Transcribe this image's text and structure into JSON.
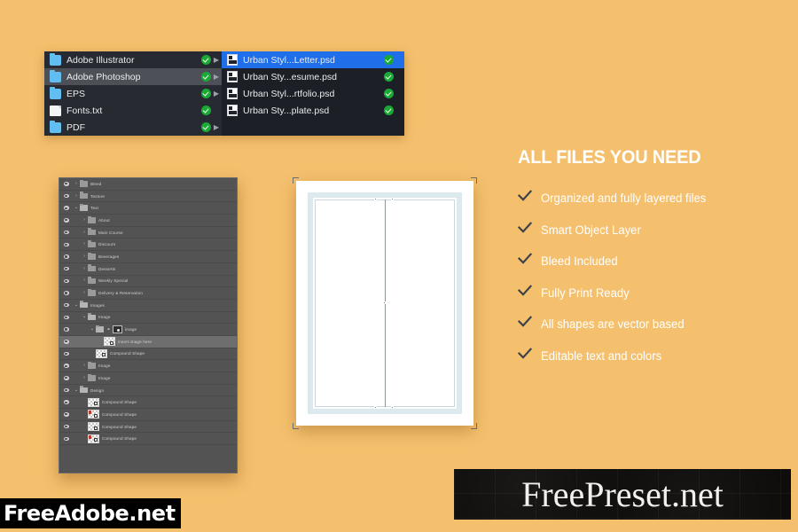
{
  "background_color": "#f4c06d",
  "file_browser": {
    "left_column": [
      {
        "name": "Adobe Illustrator",
        "icon": "folder-icon",
        "verified": true,
        "has_arrow": true,
        "selected": false
      },
      {
        "name": "Adobe Photoshop",
        "icon": "folder-icon",
        "verified": true,
        "has_arrow": true,
        "selected": true
      },
      {
        "name": "EPS",
        "icon": "folder-icon",
        "verified": true,
        "has_arrow": true,
        "selected": false
      },
      {
        "name": "Fonts.txt",
        "icon": "text-file-icon",
        "verified": true,
        "has_arrow": false,
        "selected": false
      },
      {
        "name": "PDF",
        "icon": "folder-icon",
        "verified": true,
        "has_arrow": true,
        "selected": false
      }
    ],
    "right_column": [
      {
        "name": "Urban Styl...Letter.psd",
        "icon": "psd-file-icon",
        "verified": true,
        "selected": true
      },
      {
        "name": "Urban Sty...esume.psd",
        "icon": "psd-file-icon",
        "verified": true,
        "selected": false
      },
      {
        "name": "Urban Styl...rtfolio.psd",
        "icon": "psd-file-icon",
        "verified": true,
        "selected": false
      },
      {
        "name": "Urban Sty...plate.psd",
        "icon": "psd-file-icon",
        "verified": true,
        "selected": false
      }
    ]
  },
  "layers_panel": {
    "rows": [
      {
        "name": "Bleed",
        "indent": 0,
        "kind": "folder",
        "state": "collapsed",
        "visible": true,
        "selected": false
      },
      {
        "name": "Texture",
        "indent": 0,
        "kind": "folder",
        "state": "collapsed",
        "visible": true,
        "selected": false
      },
      {
        "name": "Text",
        "indent": 0,
        "kind": "folder",
        "state": "expanded",
        "visible": true,
        "selected": false
      },
      {
        "name": "About",
        "indent": 1,
        "kind": "folder",
        "state": "collapsed",
        "visible": true,
        "selected": false
      },
      {
        "name": "Main Course",
        "indent": 1,
        "kind": "folder",
        "state": "collapsed",
        "visible": true,
        "selected": false
      },
      {
        "name": "Discount",
        "indent": 1,
        "kind": "folder",
        "state": "collapsed",
        "visible": true,
        "selected": false
      },
      {
        "name": "Beverages",
        "indent": 1,
        "kind": "folder",
        "state": "collapsed",
        "visible": true,
        "selected": false
      },
      {
        "name": "Desserts",
        "indent": 1,
        "kind": "folder",
        "state": "collapsed",
        "visible": true,
        "selected": false
      },
      {
        "name": "Weekly Special",
        "indent": 1,
        "kind": "folder",
        "state": "collapsed",
        "visible": true,
        "selected": false
      },
      {
        "name": "Delivery & Reservation",
        "indent": 1,
        "kind": "folder",
        "state": "collapsed",
        "visible": true,
        "selected": false
      },
      {
        "name": "Images",
        "indent": 0,
        "kind": "folder",
        "state": "expanded",
        "visible": true,
        "selected": false
      },
      {
        "name": "Image",
        "indent": 1,
        "kind": "folder",
        "state": "expanded",
        "visible": true,
        "selected": false
      },
      {
        "name": "image",
        "indent": 2,
        "kind": "folder-masked",
        "state": "expanded",
        "visible": true,
        "selected": false
      },
      {
        "name": "insert image here",
        "indent": 3,
        "kind": "smart-object",
        "state": "none",
        "visible": true,
        "selected": true
      },
      {
        "name": "Compound Shape",
        "indent": 2,
        "kind": "shape",
        "state": "none",
        "visible": true,
        "selected": false
      },
      {
        "name": "Image",
        "indent": 1,
        "kind": "folder",
        "state": "collapsed",
        "visible": true,
        "selected": false
      },
      {
        "name": "Image",
        "indent": 1,
        "kind": "folder",
        "state": "collapsed",
        "visible": true,
        "selected": false
      },
      {
        "name": "Design",
        "indent": 0,
        "kind": "folder",
        "state": "expanded",
        "visible": true,
        "selected": false
      },
      {
        "name": "Compound Shape",
        "indent": 1,
        "kind": "shape",
        "state": "none",
        "visible": true,
        "selected": false
      },
      {
        "name": "Compound Shape",
        "indent": 1,
        "kind": "shape-red",
        "state": "none",
        "visible": true,
        "selected": false
      },
      {
        "name": "Compound Shape",
        "indent": 1,
        "kind": "shape",
        "state": "none",
        "visible": true,
        "selected": false
      },
      {
        "name": "Compound Shape",
        "indent": 1,
        "kind": "shape-red",
        "state": "none",
        "visible": true,
        "selected": false
      }
    ]
  },
  "canvas_preview": {
    "label": "letterhead-document-preview",
    "paper_color": "#ffffff",
    "bleed_guide_color": "#dceaf0",
    "center_guide_color": "#8e9599"
  },
  "features": {
    "title": "ALL FILES YOU NEED",
    "check_color": "#3d4249",
    "items": [
      "Organized and fully layered files",
      "Smart Object Layer",
      "Bleed Included",
      "Fully Print Ready",
      "All shapes are vector based",
      "Editable text and colors"
    ]
  },
  "watermarks": {
    "bottom_left": "FreeAdobe.net",
    "bottom_right": "FreePreset.net"
  }
}
